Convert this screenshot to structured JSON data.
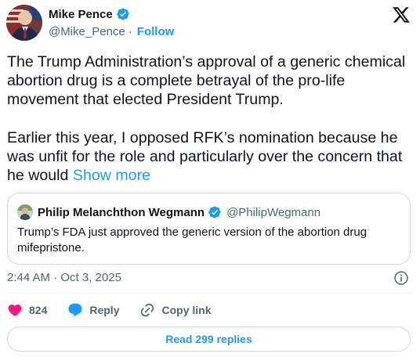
{
  "author": {
    "name": "Mike Pence",
    "handle": "@Mike_Pence",
    "separator": "·",
    "follow_label": "Follow"
  },
  "tweet": {
    "paragraph1": "The Trump Administration’s approval of a generic chemical abortion drug is a complete betrayal of the pro-life movement that elected President Trump.",
    "paragraph2": "Earlier this year, I opposed RFK’s nomination because he was unfit for the role and particularly over the concern that he would",
    "show_more": "Show more"
  },
  "quote": {
    "name": "Philip Melanchthon Wegmann",
    "handle": "@PhilipWegmann",
    "text": "Trump’s FDA just approved the generic version of the abortion drug mifepristone."
  },
  "meta": {
    "timestamp": "2:44 AM · Oct 3, 2025"
  },
  "actions": {
    "like_count": "824",
    "reply_label": "Reply",
    "copy_link_label": "Copy link"
  },
  "read_replies_label": "Read 299 replies",
  "colors": {
    "accent": "#1d9bf0",
    "like": "#f91880",
    "text": "#0f1419",
    "muted": "#536471",
    "border": "#cfd9de"
  },
  "icons": {
    "logo": "x-logo-icon",
    "verified": "verified-badge-icon",
    "info": "info-icon",
    "like": "heart-icon",
    "reply": "reply-bubble-icon",
    "copy_link": "link-icon"
  }
}
